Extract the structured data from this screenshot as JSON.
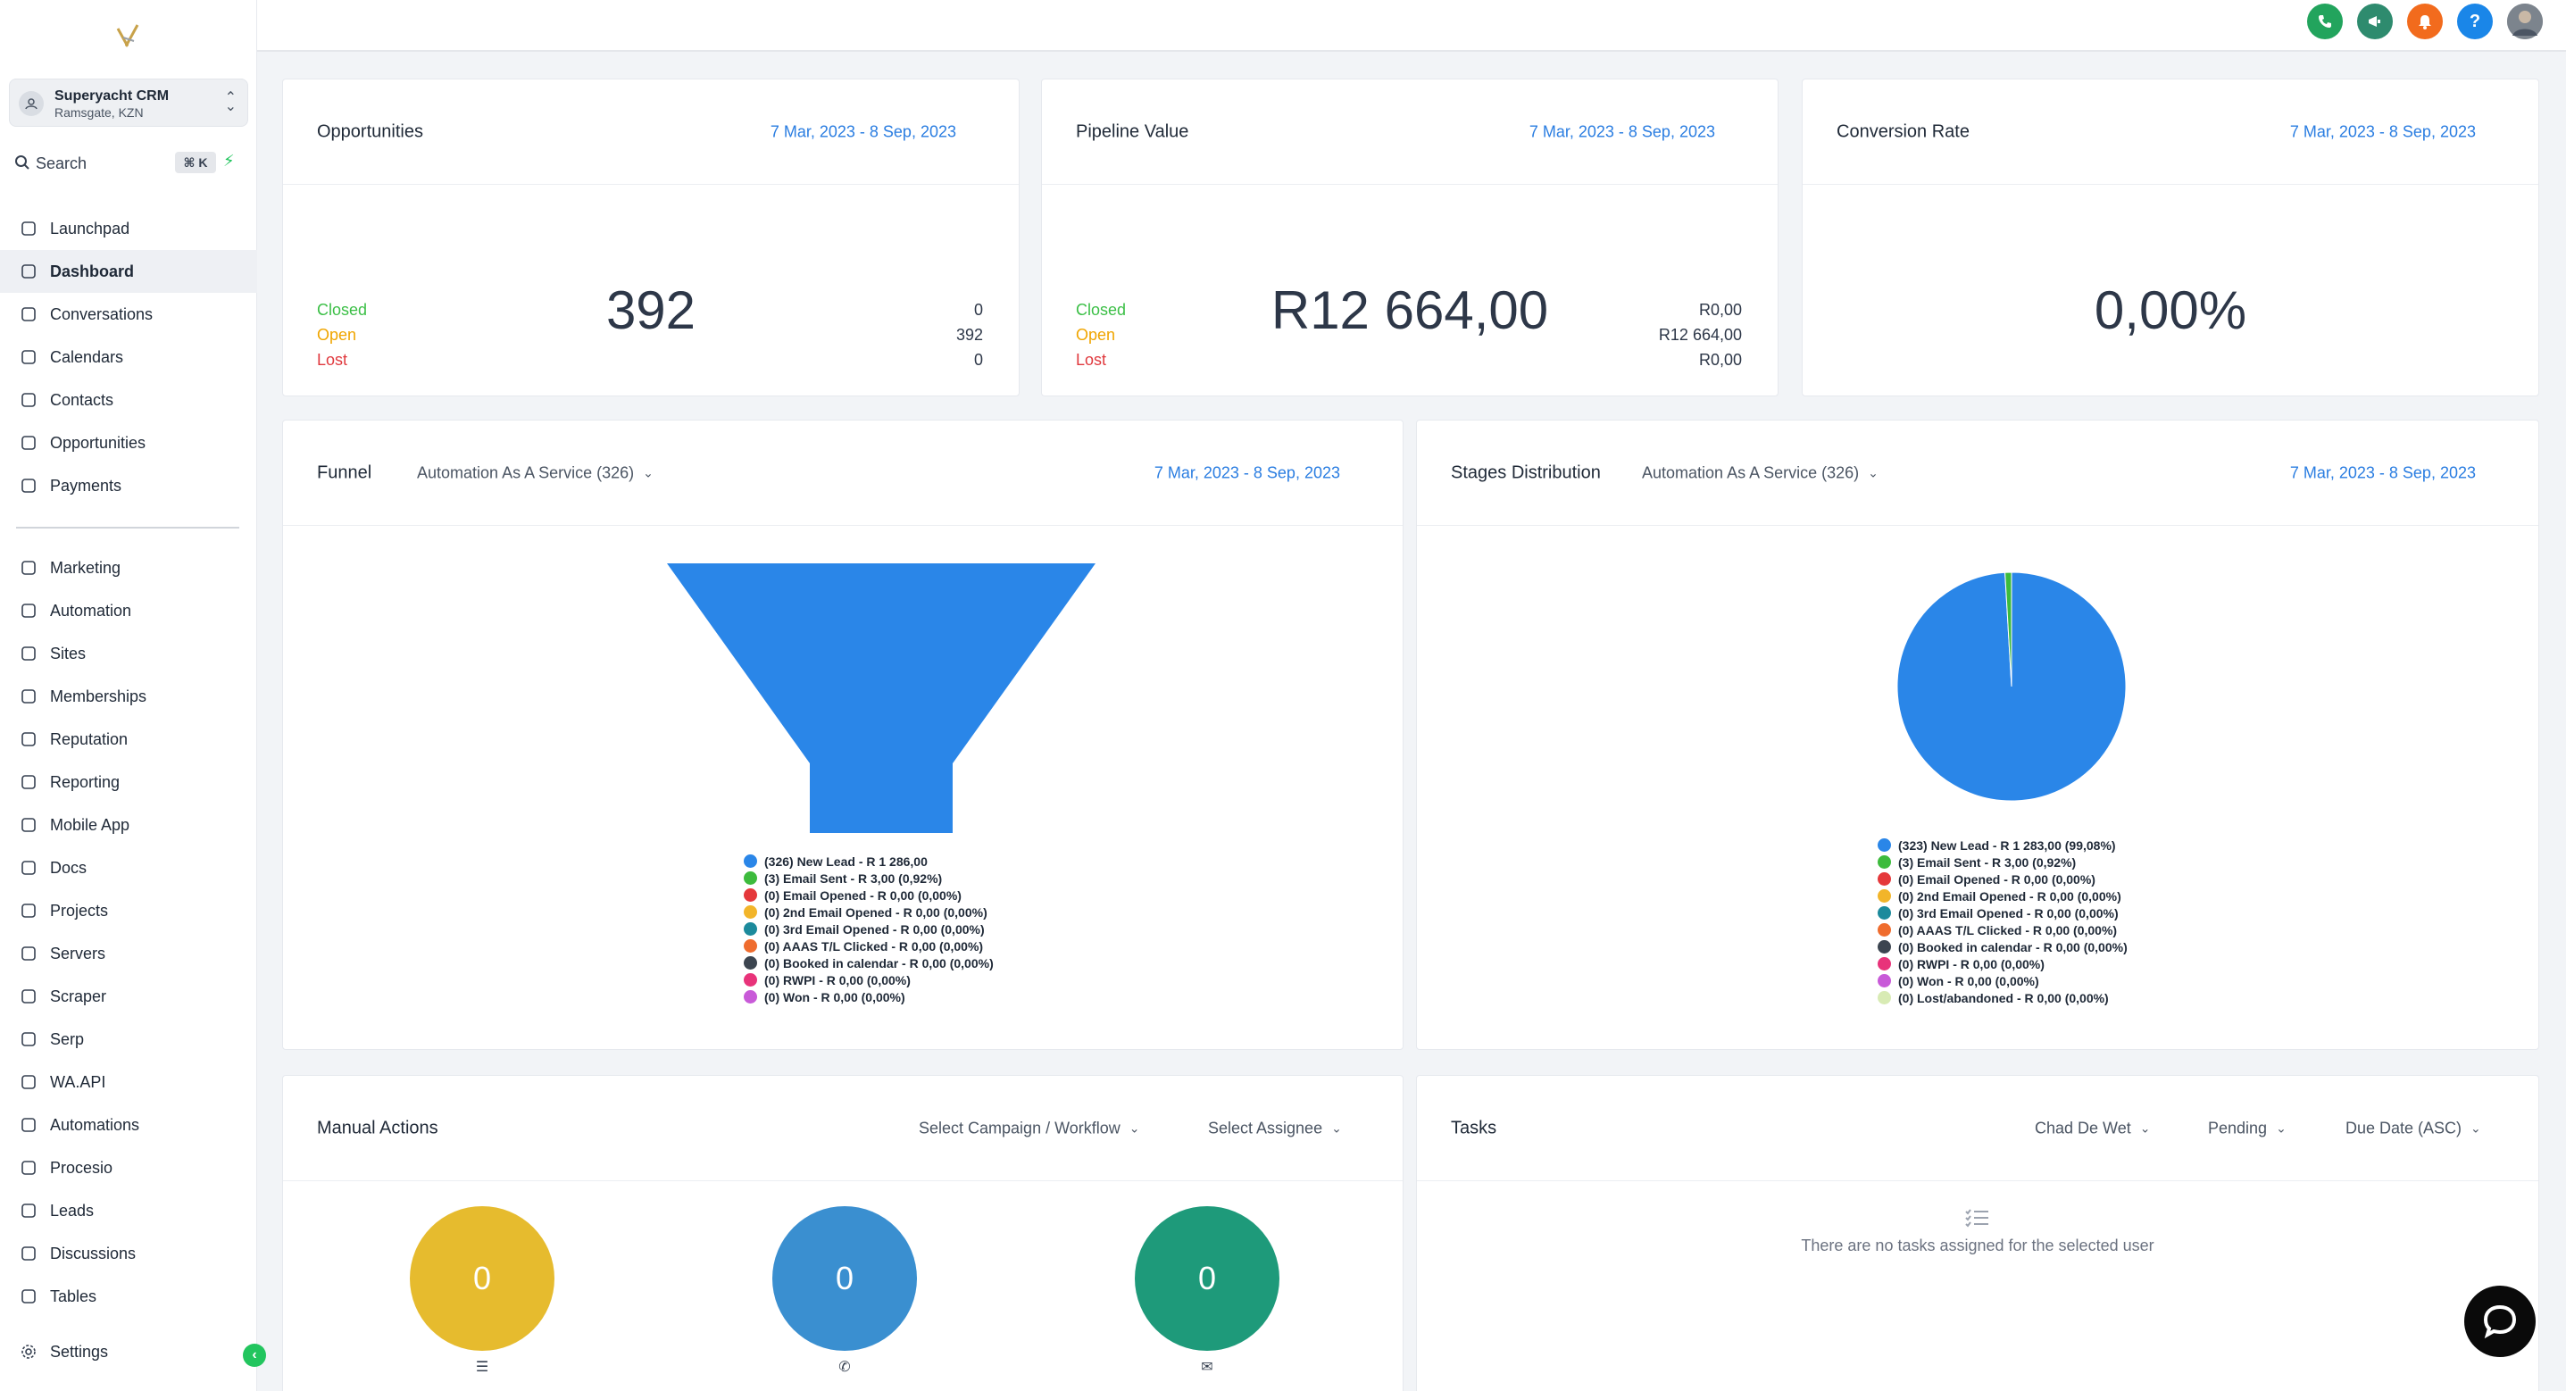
{
  "account": {
    "name": "Superyacht CRM",
    "location": "Ramsgate, KZN"
  },
  "search": {
    "label": "Search",
    "shortcut": "⌘ K"
  },
  "nav_primary": [
    {
      "label": "Launchpad",
      "icon": "rocket-icon"
    },
    {
      "label": "Dashboard",
      "icon": "grid-icon",
      "active": true
    },
    {
      "label": "Conversations",
      "icon": "chat-icon"
    },
    {
      "label": "Calendars",
      "icon": "calendar-icon"
    },
    {
      "label": "Contacts",
      "icon": "contacts-icon"
    },
    {
      "label": "Opportunities",
      "icon": "opportunities-icon"
    },
    {
      "label": "Payments",
      "icon": "payments-icon"
    }
  ],
  "nav_secondary": [
    {
      "label": "Marketing",
      "icon": "send-icon"
    },
    {
      "label": "Automation",
      "icon": "automation-icon"
    },
    {
      "label": "Sites",
      "icon": "sites-icon"
    },
    {
      "label": "Memberships",
      "icon": "award-icon"
    },
    {
      "label": "Reputation",
      "icon": "star-icon"
    },
    {
      "label": "Reporting",
      "icon": "trend-icon"
    },
    {
      "label": "Mobile App",
      "icon": "phone-icon"
    },
    {
      "label": "Docs",
      "icon": "info-icon"
    },
    {
      "label": "Projects",
      "icon": "list-icon"
    },
    {
      "label": "Servers",
      "icon": "server-icon"
    },
    {
      "label": "Scraper",
      "icon": "scraper-icon"
    },
    {
      "label": "Serp",
      "icon": "magnifier-icon"
    },
    {
      "label": "WA.API",
      "icon": "whatsapp-icon"
    },
    {
      "label": "Automations",
      "icon": "automations-icon"
    },
    {
      "label": "Procesio",
      "icon": "procesio-icon"
    },
    {
      "label": "Leads",
      "icon": "walk-icon"
    },
    {
      "label": "Discussions",
      "icon": "discussions-icon"
    },
    {
      "label": "Tables",
      "icon": "tables-icon"
    }
  ],
  "settings_label": "Settings",
  "topbar": {
    "avatar_initials": ""
  },
  "date_range": "7 Mar, 2023 - 8 Sep, 2023",
  "opportunities": {
    "title": "Opportunities",
    "total": "392",
    "rows": [
      {
        "label": "Closed",
        "value": "0"
      },
      {
        "label": "Open",
        "value": "392"
      },
      {
        "label": "Lost",
        "value": "0"
      }
    ]
  },
  "pipeline": {
    "title": "Pipeline Value",
    "total": "R12 664,00",
    "rows": [
      {
        "label": "Closed",
        "value": "R0,00"
      },
      {
        "label": "Open",
        "value": "R12 664,00"
      },
      {
        "label": "Lost",
        "value": "R0,00"
      }
    ]
  },
  "conversion": {
    "title": "Conversion Rate",
    "total": "0,00%"
  },
  "funnel": {
    "title": "Funnel",
    "pipeline_select": "Automation As A Service (326)",
    "legend": [
      {
        "label": "(326) New Lead - R 1 286,00",
        "color": "#2a86e8"
      },
      {
        "label": "(3) Email Sent - R 3,00 (0,92%)",
        "color": "#3dbb3d"
      },
      {
        "label": "(0) Email Opened - R 0,00 (0,00%)",
        "color": "#e5383b"
      },
      {
        "label": "(0) 2nd Email Opened - R 0,00 (0,00%)",
        "color": "#f2b52a"
      },
      {
        "label": "(0) 3rd Email Opened - R 0,00 (0,00%)",
        "color": "#1c8a9c"
      },
      {
        "label": "(0) AAAS T/L Clicked - R 0,00 (0,00%)",
        "color": "#ef6c2e"
      },
      {
        "label": "(0) Booked in calendar - R 0,00 (0,00%)",
        "color": "#3c4550"
      },
      {
        "label": "(0) RWPI - R 0,00 (0,00%)",
        "color": "#e8337a"
      },
      {
        "label": "(0) Won - R 0,00 (0,00%)",
        "color": "#c85ad8"
      }
    ]
  },
  "stages": {
    "title": "Stages Distribution",
    "pipeline_select": "Automation As A Service (326)",
    "legend": [
      {
        "label": "(323) New Lead - R 1 283,00 (99,08%)",
        "color": "#2a86e8"
      },
      {
        "label": "(3) Email Sent - R 3,00 (0,92%)",
        "color": "#3dbb3d"
      },
      {
        "label": "(0) Email Opened - R 0,00 (0,00%)",
        "color": "#e5383b"
      },
      {
        "label": "(0) 2nd Email Opened - R 0,00 (0,00%)",
        "color": "#f2b52a"
      },
      {
        "label": "(0) 3rd Email Opened - R 0,00 (0,00%)",
        "color": "#1c8a9c"
      },
      {
        "label": "(0) AAAS T/L Clicked - R 0,00 (0,00%)",
        "color": "#ef6c2e"
      },
      {
        "label": "(0) Booked in calendar - R 0,00 (0,00%)",
        "color": "#3c4550"
      },
      {
        "label": "(0) RWPI - R 0,00 (0,00%)",
        "color": "#e8337a"
      },
      {
        "label": "(0) Won - R 0,00 (0,00%)",
        "color": "#c85ad8"
      },
      {
        "label": "(0) Lost/abandoned - R 0,00 (0,00%)",
        "color": "#d8ebb4"
      }
    ]
  },
  "chart_data": [
    {
      "type": "funnel",
      "categories": [
        "New Lead",
        "Email Sent",
        "Email Opened",
        "2nd Email Opened",
        "3rd Email Opened",
        "AAAS T/L Clicked",
        "Booked in calendar",
        "RWPI",
        "Won"
      ],
      "values": [
        326,
        3,
        0,
        0,
        0,
        0,
        0,
        0,
        0
      ],
      "amounts": [
        1286,
        3,
        0,
        0,
        0,
        0,
        0,
        0,
        0
      ]
    },
    {
      "type": "pie",
      "categories": [
        "New Lead",
        "Email Sent",
        "Email Opened",
        "2nd Email Opened",
        "3rd Email Opened",
        "AAAS T/L Clicked",
        "Booked in calendar",
        "RWPI",
        "Won",
        "Lost/abandoned"
      ],
      "values": [
        323,
        3,
        0,
        0,
        0,
        0,
        0,
        0,
        0,
        0
      ],
      "percent": [
        99.08,
        0.92,
        0,
        0,
        0,
        0,
        0,
        0,
        0,
        0
      ]
    }
  ],
  "manual_actions": {
    "title": "Manual Actions",
    "campaign_select": "Select Campaign / Workflow",
    "assignee_select": "Select Assignee",
    "circles": [
      {
        "value": "0",
        "color": "#e6bb2e",
        "icon": "list-check-icon",
        "glyph": "☰"
      },
      {
        "value": "0",
        "color": "#3a8fd0",
        "icon": "phone-icon",
        "glyph": "✆"
      },
      {
        "value": "0",
        "color": "#1e9a7a",
        "icon": "sms-icon",
        "glyph": "✉"
      }
    ]
  },
  "tasks": {
    "title": "Tasks",
    "user_select": "Chad De Wet",
    "status_select": "Pending",
    "sort_select": "Due Date (ASC)",
    "empty_message": "There are no tasks assigned for the selected user"
  }
}
